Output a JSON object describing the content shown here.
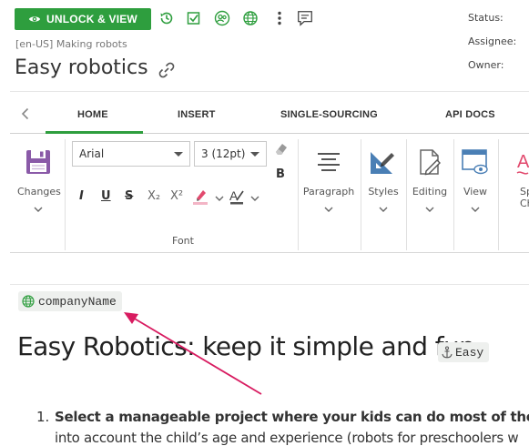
{
  "toolbar": {
    "unlock_label": "UNLOCK & VIEW",
    "icons": [
      "history-icon",
      "checkbox-icon",
      "people-icon",
      "globe-icon",
      "more-icon",
      "comment-icon"
    ]
  },
  "doc": {
    "breadcrumb": "[en-US] Making robots",
    "title": "Easy robotics"
  },
  "meta": {
    "status_label": "Status:",
    "assignee_label": "Assignee:",
    "owner_label": "Owner:"
  },
  "tabs": [
    {
      "label": "HOME",
      "active": true
    },
    {
      "label": "INSERT",
      "active": false
    },
    {
      "label": "SINGLE-SOURCING",
      "active": false
    },
    {
      "label": "API DOCS",
      "active": false
    }
  ],
  "ribbon": {
    "changes_label": "Changes",
    "font_family": "Arial",
    "font_size": "3 (12pt)",
    "bold": "B",
    "italic": "I",
    "underline": "U",
    "strike": "S",
    "subscript": "X₂",
    "superscript": "X²",
    "font_group_label": "Font",
    "paragraph_label": "Paragraph",
    "styles_label": "Styles",
    "editing_label": "Editing",
    "view_label": "View",
    "spell_label_line1": "Sp",
    "spell_label_line2": "Chec"
  },
  "editor": {
    "variable_name": "companyName",
    "heading": "Easy Robotics: keep it simple and fun",
    "anchor_name": "Easy",
    "list_number": "1.",
    "list_line1": "Select a manageable project where your kids can do most of the work",
    "list_line2": "into account the child’s age and experience (robots for preschoolers w"
  },
  "colors": {
    "accent_green": "#2e9e3e",
    "arrow_red": "#d81b60",
    "styles_blue": "#4a7fb5",
    "save_purple": "#7e4d9e"
  }
}
